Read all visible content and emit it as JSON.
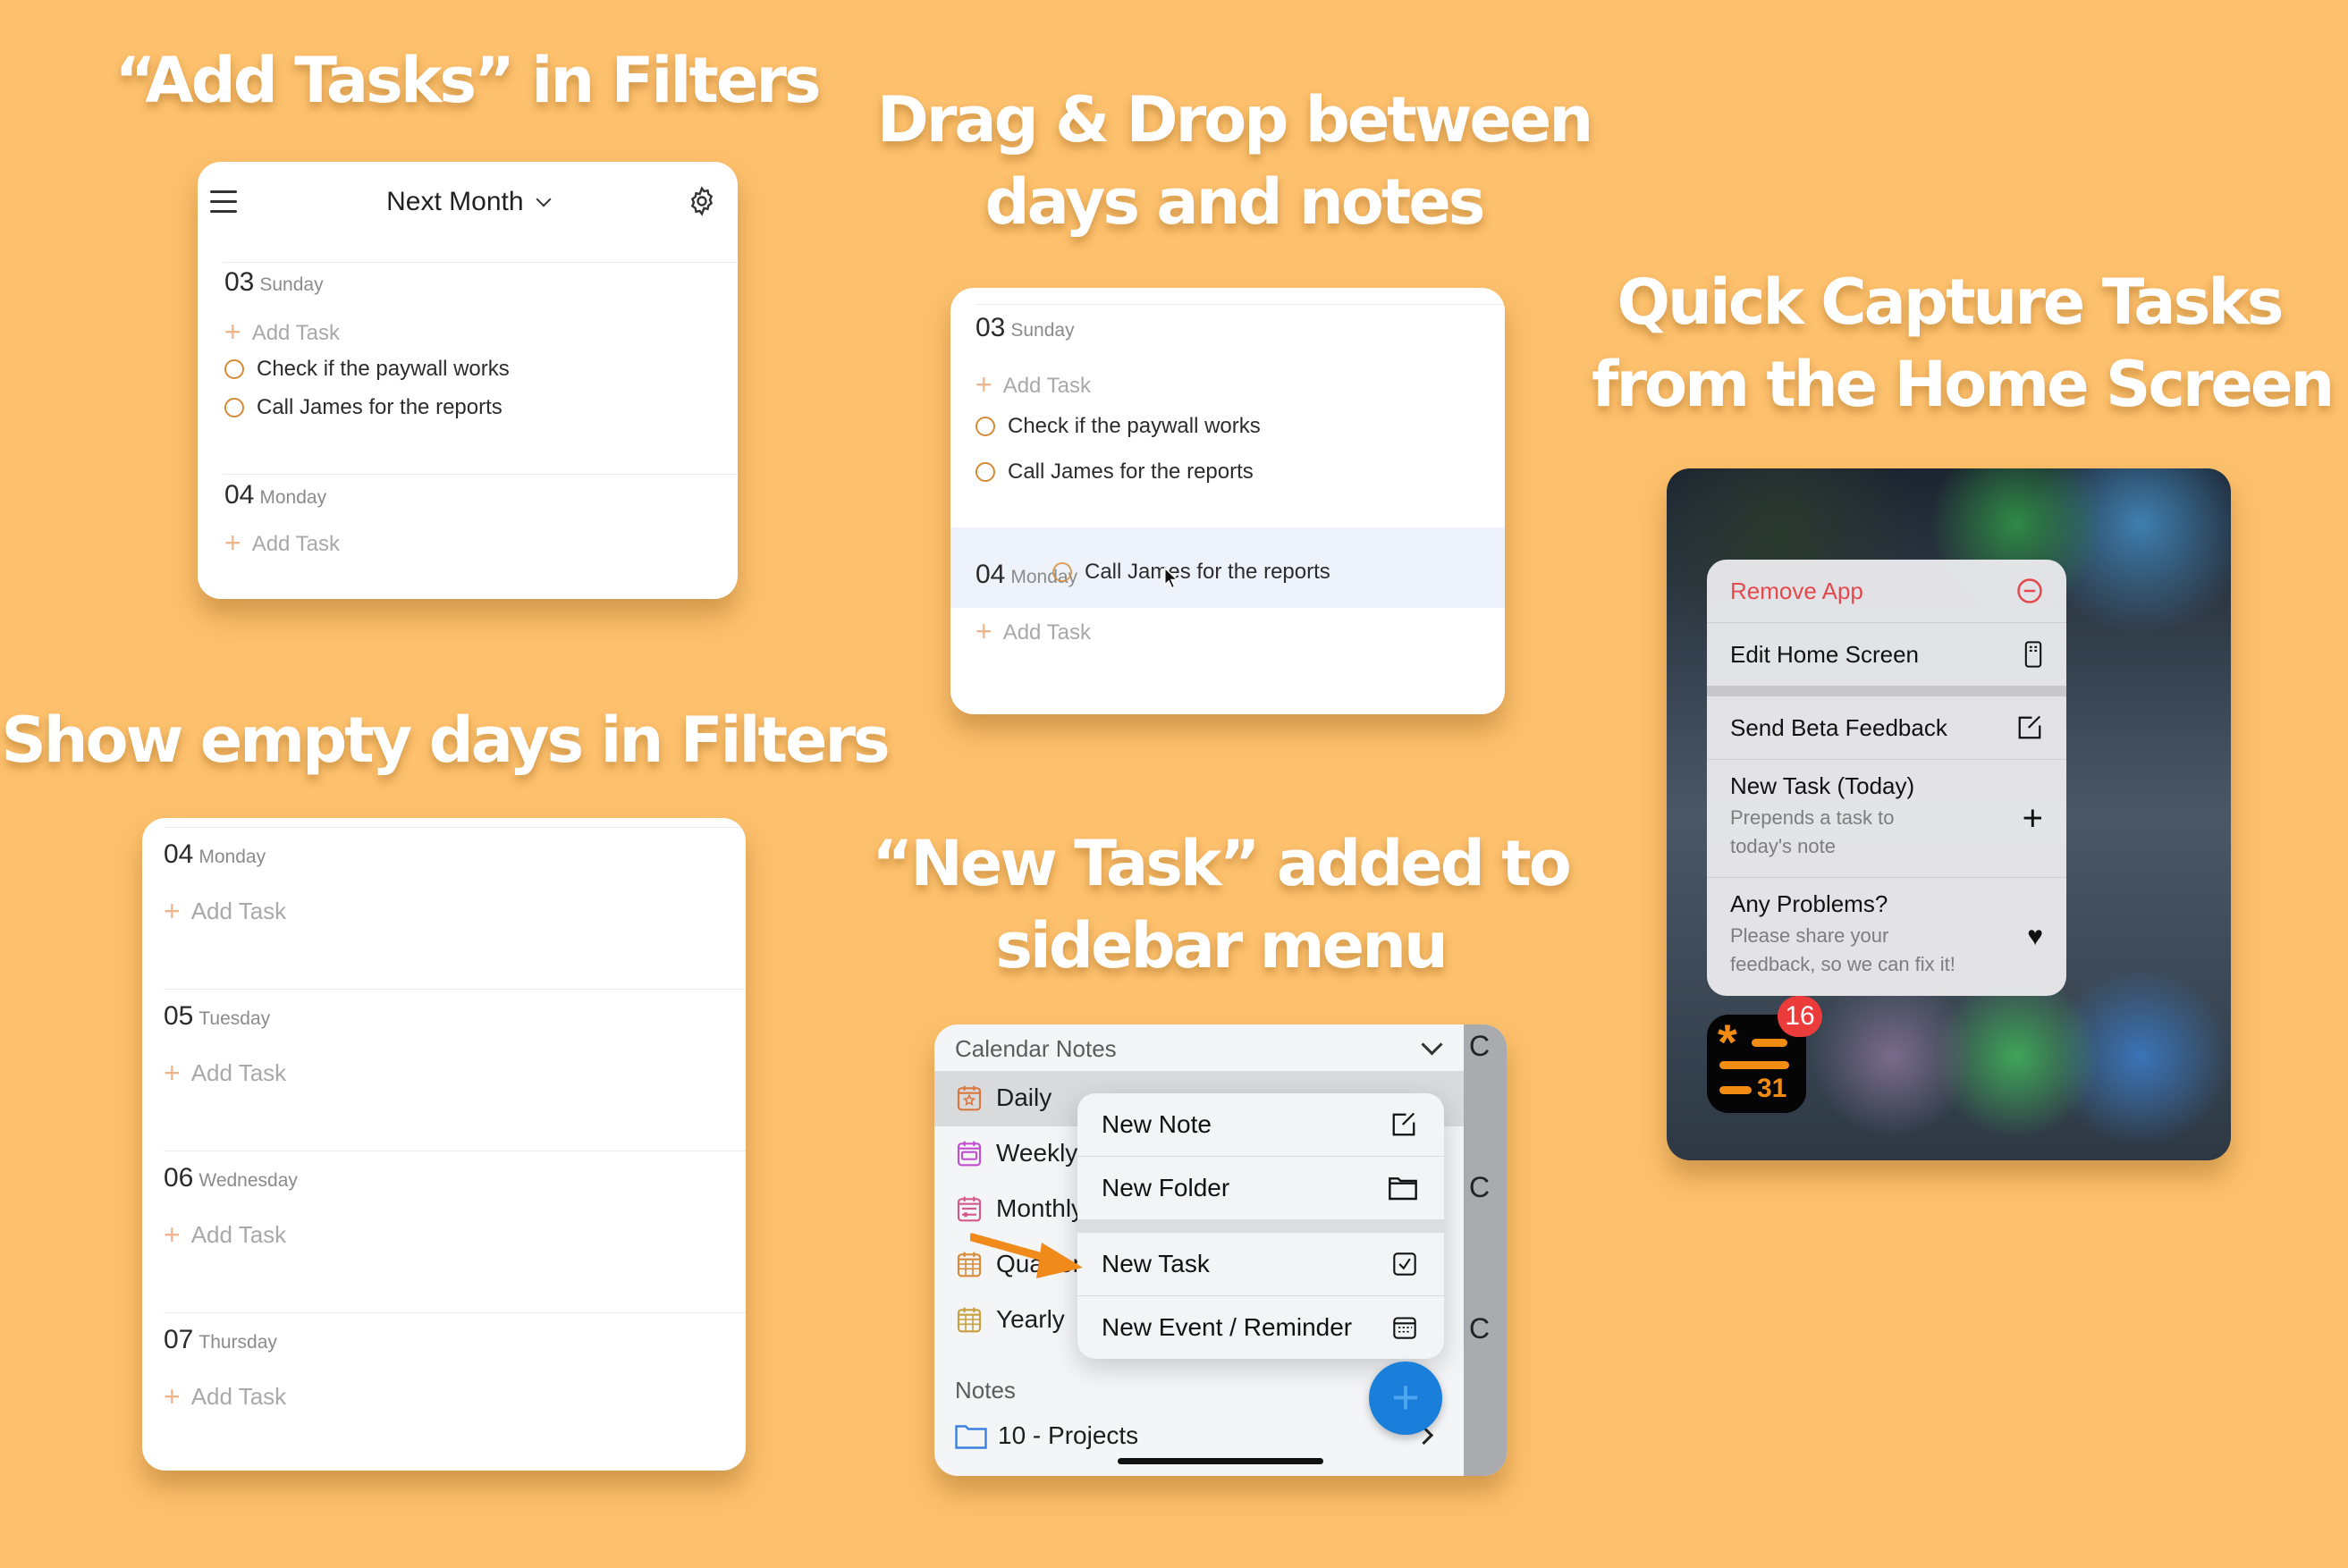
{
  "colors": {
    "background": "#FDC06C",
    "accent_orange": "#D68A35",
    "destructive": "#E5484D",
    "fab_blue": "#1A7FDB"
  },
  "headlines": {
    "add_tasks": "“Add Tasks” in Filters",
    "drag_drop": [
      "Drag & Drop between",
      "days and notes"
    ],
    "quick_capture": [
      "Quick Capture Tasks",
      "from the Home Screen"
    ],
    "empty_days": "Show empty days in Filters",
    "new_task": [
      "“New Task” added to",
      "sidebar menu"
    ]
  },
  "filters_panel": {
    "menu_icon": "hamburger-icon",
    "title": "Next Month",
    "title_chevron": "⌄",
    "settings_icon": "gear-icon",
    "days": [
      {
        "num": "03",
        "name": "Sunday",
        "add_label": "Add Task",
        "tasks": [
          "Check if the paywall works",
          "Call James for the reports"
        ]
      },
      {
        "num": "04",
        "name": "Monday",
        "add_label": "Add Task",
        "tasks": []
      }
    ]
  },
  "drag_panel": {
    "days": [
      {
        "num": "03",
        "name": "Sunday",
        "add_label": "Add Task",
        "tasks": [
          "Check if the paywall works",
          "Call James for the reports"
        ]
      },
      {
        "num": "04",
        "name": "Monday",
        "add_label": "Add Task"
      }
    ],
    "dragged_task": "Call James for the reports"
  },
  "empty_days_panel": {
    "days": [
      {
        "num": "04",
        "name": "Monday",
        "add_label": "Add Task"
      },
      {
        "num": "05",
        "name": "Tuesday",
        "add_label": "Add Task"
      },
      {
        "num": "06",
        "name": "Wednesday",
        "add_label": "Add Task"
      },
      {
        "num": "07",
        "name": "Thursday",
        "add_label": "Add Task"
      }
    ]
  },
  "sidebar_panel": {
    "section_calendar": "Calendar Notes",
    "items": [
      {
        "label": "Daily",
        "icon": "calendar-star-icon",
        "color": "#D9773E"
      },
      {
        "label": "Weekly",
        "icon": "calendar-week-icon",
        "color": "#C24FD0"
      },
      {
        "label": "Monthly",
        "icon": "calendar-month-icon",
        "color": "#D25A8C"
      },
      {
        "label": "Quarterly",
        "icon": "calendar-grid-icon",
        "color": "#D98A3A"
      },
      {
        "label": "Yearly",
        "icon": "calendar-grid-icon",
        "color": "#C8A040"
      }
    ],
    "section_notes": "Notes",
    "folder": "10 - Projects",
    "menu": [
      {
        "label": "New Note",
        "icon": "compose-icon"
      },
      {
        "label": "New Folder",
        "icon": "folder-icon"
      },
      {
        "label": "New Task",
        "icon": "checkbox-icon"
      },
      {
        "label": "New Event / Reminder",
        "icon": "calendar-icon"
      }
    ],
    "peek_letter": "C"
  },
  "home_panel": {
    "menu": [
      {
        "title": "Remove App",
        "icon": "minus-circle-icon",
        "destructive": true
      },
      {
        "title": "Edit Home Screen",
        "icon": "phone-apps-icon"
      },
      {
        "title": "Send Beta Feedback",
        "icon": "compose-icon"
      },
      {
        "title": "New Task (Today)",
        "subtitle": [
          "Prepends a task to",
          "today's note"
        ],
        "icon": "plus-icon"
      },
      {
        "title": "Any Problems?",
        "subtitle": [
          "Please share your",
          "feedback, so we can fix it!"
        ],
        "icon": "heart-icon"
      }
    ],
    "app_icon_text": "31",
    "badge_count": "16"
  }
}
